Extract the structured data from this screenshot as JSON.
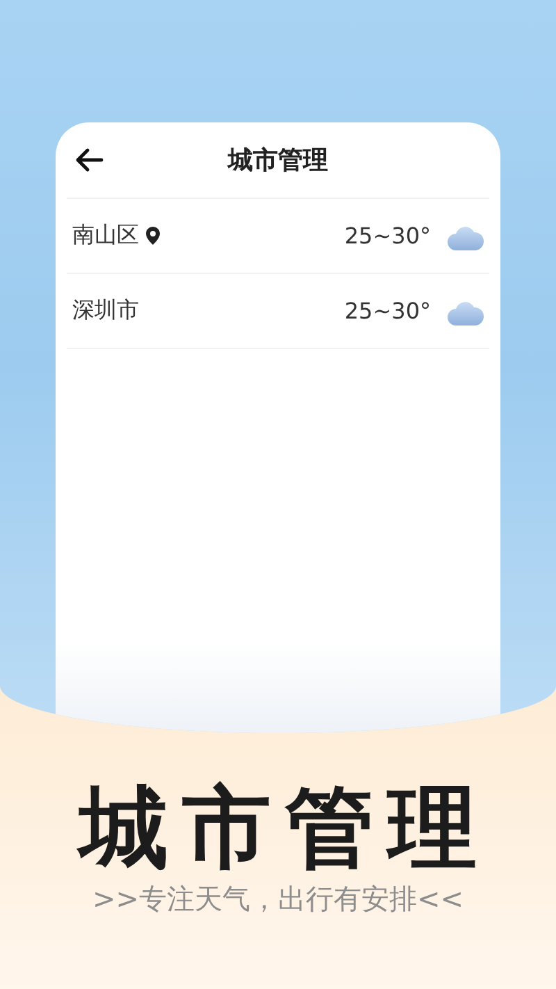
{
  "screen": {
    "title": "城市管理"
  },
  "cities": [
    {
      "name": "南山区",
      "current_location": true,
      "temperature": "25~30°"
    },
    {
      "name": "深圳市",
      "current_location": false,
      "temperature": "25~30°"
    }
  ],
  "banner": {
    "headline": "城市管理",
    "tagline": ">>专注天气，出行有安排<<"
  }
}
